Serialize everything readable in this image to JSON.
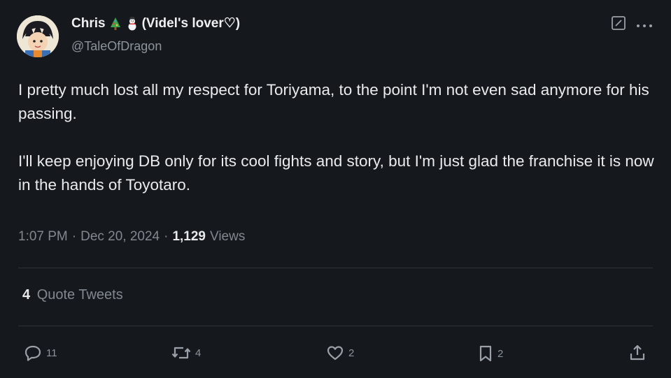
{
  "user": {
    "display_name": "Chris",
    "display_suffix": "(Videl's lover♡)",
    "handle": "@TaleOfDragon",
    "emojis": [
      "christmas-tree-icon",
      "snowman-icon"
    ]
  },
  "tweet": {
    "paragraphs": [
      "I pretty much lost all my respect for Toriyama, to the point I'm not even sad anymore for his passing.",
      "I'll keep enjoying DB only for its cool fights and story, but I'm just glad the franchise it is now in the hands of Toyotaro."
    ],
    "time": "1:07 PM",
    "date": "Dec 20, 2024",
    "sep1": "·",
    "sep2": "·",
    "views_count": "1,129",
    "views_label": "Views"
  },
  "quotes": {
    "count": "4",
    "label": "Quote Tweets"
  },
  "actions": {
    "reply_count": "11",
    "retweet_count": "4",
    "like_count": "2",
    "bookmark_count": "2"
  },
  "header_icons": [
    "edit-icon",
    "more-icon"
  ],
  "colors": {
    "background": "#15181c",
    "text": "#e7e9ea",
    "muted": "#81888f",
    "divider": "#2f3336"
  }
}
